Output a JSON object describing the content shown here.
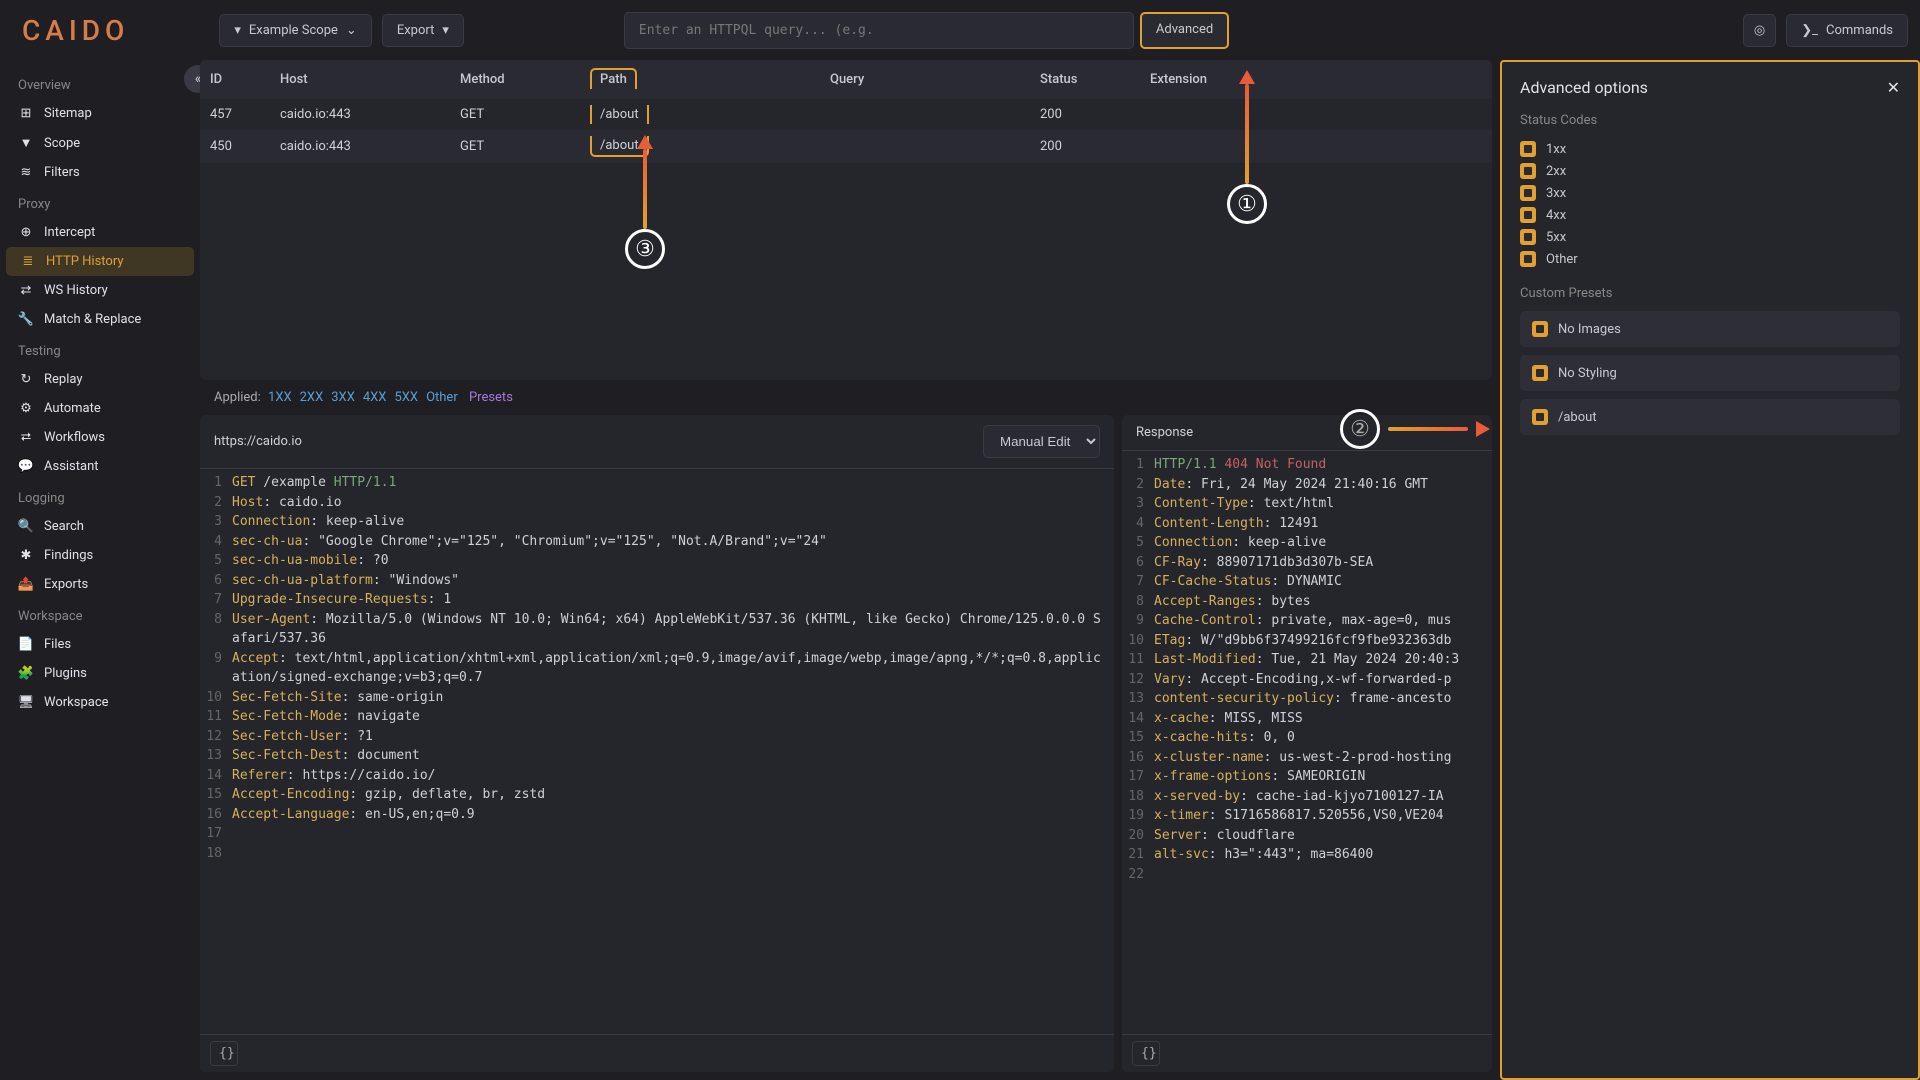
{
  "app": {
    "logo": "CAIDO"
  },
  "topbar": {
    "scope_label": "Example Scope",
    "export_label": "Export",
    "search_placeholder": "Enter an HTTPQL query... (e.g.",
    "advanced_label": "Advanced",
    "commands_label": "Commands"
  },
  "sidebar": {
    "sections": [
      {
        "title": "Overview",
        "items": [
          {
            "icon": "sitemap-icon",
            "glyph": "⊞",
            "label": "Sitemap"
          },
          {
            "icon": "scope-icon",
            "glyph": "▼",
            "label": "Scope"
          },
          {
            "icon": "filters-icon",
            "glyph": "≋",
            "label": "Filters"
          }
        ]
      },
      {
        "title": "Proxy",
        "items": [
          {
            "icon": "intercept-icon",
            "glyph": "⊕",
            "label": "Intercept"
          },
          {
            "icon": "history-icon",
            "glyph": "≣",
            "label": "HTTP History",
            "active": true
          },
          {
            "icon": "ws-icon",
            "glyph": "⇄",
            "label": "WS History"
          },
          {
            "icon": "match-icon",
            "glyph": "🔧",
            "label": "Match & Replace"
          }
        ]
      },
      {
        "title": "Testing",
        "items": [
          {
            "icon": "replay-icon",
            "glyph": "↻",
            "label": "Replay"
          },
          {
            "icon": "automate-icon",
            "glyph": "⚙",
            "label": "Automate"
          },
          {
            "icon": "workflow-icon",
            "glyph": "⮂",
            "label": "Workflows"
          },
          {
            "icon": "assistant-icon",
            "glyph": "💬",
            "label": "Assistant"
          }
        ]
      },
      {
        "title": "Logging",
        "items": [
          {
            "icon": "search-icon",
            "glyph": "🔍",
            "label": "Search"
          },
          {
            "icon": "findings-icon",
            "glyph": "✱",
            "label": "Findings"
          },
          {
            "icon": "exports-icon",
            "glyph": "📤",
            "label": "Exports"
          }
        ]
      },
      {
        "title": "Workspace",
        "items": [
          {
            "icon": "files-icon",
            "glyph": "📄",
            "label": "Files"
          },
          {
            "icon": "plugins-icon",
            "glyph": "🧩",
            "label": "Plugins"
          },
          {
            "icon": "workspace-icon",
            "glyph": "🖥",
            "label": "Workspace"
          }
        ]
      }
    ]
  },
  "table": {
    "columns": [
      "ID",
      "Host",
      "Method",
      "Path",
      "Query",
      "Status",
      "Extension"
    ],
    "rows": [
      {
        "id": "457",
        "host": "caido.io:443",
        "method": "GET",
        "path": "/about",
        "query": "",
        "status": "200",
        "ext": ""
      },
      {
        "id": "450",
        "host": "caido.io:443",
        "method": "GET",
        "path": "/about",
        "query": "",
        "status": "200",
        "ext": ""
      }
    ]
  },
  "applied": {
    "label": "Applied:",
    "chips": [
      "1XX",
      "2XX",
      "3XX",
      "4XX",
      "5XX",
      "Other"
    ],
    "presets_label": "Presets"
  },
  "request": {
    "url": "https://caido.io",
    "mode_label": "Manual Edit",
    "lines": [
      [
        {
          "c": "kw-y",
          "t": "GET"
        },
        {
          "c": "",
          "t": " /example "
        },
        {
          "c": "kw-g",
          "t": "HTTP/1.1"
        }
      ],
      [
        {
          "c": "kw-y",
          "t": "Host"
        },
        {
          "c": "",
          "t": ": caido.io"
        }
      ],
      [
        {
          "c": "kw-y",
          "t": "Connection"
        },
        {
          "c": "",
          "t": ": keep-alive"
        }
      ],
      [
        {
          "c": "kw-y",
          "t": "sec-ch-ua"
        },
        {
          "c": "",
          "t": ": \"Google Chrome\";v=\"125\", \"Chromium\";v=\"125\", \"Not.A/Brand\";v=\"24\""
        }
      ],
      [
        {
          "c": "kw-y",
          "t": "sec-ch-ua-mobile"
        },
        {
          "c": "",
          "t": ": ?0"
        }
      ],
      [
        {
          "c": "kw-y",
          "t": "sec-ch-ua-platform"
        },
        {
          "c": "",
          "t": ": \"Windows\""
        }
      ],
      [
        {
          "c": "kw-y",
          "t": "Upgrade-Insecure-Requests"
        },
        {
          "c": "",
          "t": ": 1"
        }
      ],
      [
        {
          "c": "kw-y",
          "t": "User-Agent"
        },
        {
          "c": "",
          "t": ": Mozilla/5.0 (Windows NT 10.0; Win64; x64) AppleWebKit/537.36 (KHTML, like Gecko) Chrome/125.0.0.0 Safari/537.36"
        }
      ],
      [
        {
          "c": "kw-y",
          "t": "Accept"
        },
        {
          "c": "",
          "t": ": text/html,application/xhtml+xml,application/xml;q=0.9,image/avif,image/webp,image/apng,*/*;q=0.8,application/signed-exchange;v=b3;q=0.7"
        }
      ],
      [
        {
          "c": "kw-y",
          "t": "Sec-Fetch-Site"
        },
        {
          "c": "",
          "t": ": same-origin"
        }
      ],
      [
        {
          "c": "kw-y",
          "t": "Sec-Fetch-Mode"
        },
        {
          "c": "",
          "t": ": navigate"
        }
      ],
      [
        {
          "c": "kw-y",
          "t": "Sec-Fetch-User"
        },
        {
          "c": "",
          "t": ": ?1"
        }
      ],
      [
        {
          "c": "kw-y",
          "t": "Sec-Fetch-Dest"
        },
        {
          "c": "",
          "t": ": document"
        }
      ],
      [
        {
          "c": "kw-y",
          "t": "Referer"
        },
        {
          "c": "",
          "t": ": https://caido.io/"
        }
      ],
      [
        {
          "c": "kw-y",
          "t": "Accept-Encoding"
        },
        {
          "c": "",
          "t": ": gzip, deflate, br, zstd"
        }
      ],
      [
        {
          "c": "kw-y",
          "t": "Accept-Language"
        },
        {
          "c": "",
          "t": ": en-US,en;q=0.9"
        }
      ],
      [
        {
          "c": "",
          "t": ""
        }
      ],
      [
        {
          "c": "",
          "t": ""
        }
      ]
    ]
  },
  "response": {
    "title": "Response",
    "lines": [
      [
        {
          "c": "kw-g",
          "t": "HTTP/1.1 "
        },
        {
          "c": "kw-r",
          "t": "404 Not Found"
        }
      ],
      [
        {
          "c": "kw-y",
          "t": "Date"
        },
        {
          "c": "",
          "t": ": Fri, 24 May 2024 21:40:16 GMT"
        }
      ],
      [
        {
          "c": "kw-y",
          "t": "Content-Type"
        },
        {
          "c": "",
          "t": ": text/html"
        }
      ],
      [
        {
          "c": "kw-y",
          "t": "Content-Length"
        },
        {
          "c": "",
          "t": ": 12491"
        }
      ],
      [
        {
          "c": "kw-y",
          "t": "Connection"
        },
        {
          "c": "",
          "t": ": keep-alive"
        }
      ],
      [
        {
          "c": "kw-y",
          "t": "CF-Ray"
        },
        {
          "c": "",
          "t": ": 88907171db3d307b-SEA"
        }
      ],
      [
        {
          "c": "kw-y",
          "t": "CF-Cache-Status"
        },
        {
          "c": "",
          "t": ": DYNAMIC"
        }
      ],
      [
        {
          "c": "kw-y",
          "t": "Accept-Ranges"
        },
        {
          "c": "",
          "t": ": bytes"
        }
      ],
      [
        {
          "c": "kw-y",
          "t": "Cache-Control"
        },
        {
          "c": "",
          "t": ": private, max-age=0, mus"
        }
      ],
      [
        {
          "c": "kw-y",
          "t": "ETag"
        },
        {
          "c": "",
          "t": ": W/\"d9bb6f37499216fcf9fbe932363db"
        }
      ],
      [
        {
          "c": "kw-y",
          "t": "Last-Modified"
        },
        {
          "c": "",
          "t": ": Tue, 21 May 2024 20:40:3"
        }
      ],
      [
        {
          "c": "kw-y",
          "t": "Vary"
        },
        {
          "c": "",
          "t": ": Accept-Encoding,x-wf-forwarded-p"
        }
      ],
      [
        {
          "c": "kw-y",
          "t": "content-security-policy"
        },
        {
          "c": "",
          "t": ": frame-ancesto"
        }
      ],
      [
        {
          "c": "kw-y",
          "t": "x-cache"
        },
        {
          "c": "",
          "t": ": MISS, MISS"
        }
      ],
      [
        {
          "c": "kw-y",
          "t": "x-cache-hits"
        },
        {
          "c": "",
          "t": ": 0, 0"
        }
      ],
      [
        {
          "c": "kw-y",
          "t": "x-cluster-name"
        },
        {
          "c": "",
          "t": ": us-west-2-prod-hosting"
        }
      ],
      [
        {
          "c": "kw-y",
          "t": "x-frame-options"
        },
        {
          "c": "",
          "t": ": SAMEORIGIN"
        }
      ],
      [
        {
          "c": "kw-y",
          "t": "x-served-by"
        },
        {
          "c": "",
          "t": ": cache-iad-kjyo7100127-IA"
        }
      ],
      [
        {
          "c": "kw-y",
          "t": "x-timer"
        },
        {
          "c": "",
          "t": ": S1716586817.520556,VS0,VE204"
        }
      ],
      [
        {
          "c": "kw-y",
          "t": "Server"
        },
        {
          "c": "",
          "t": ": cloudflare"
        }
      ],
      [
        {
          "c": "kw-y",
          "t": "alt-svc"
        },
        {
          "c": "",
          "t": ": h3=\":443\"; ma=86400"
        }
      ],
      [
        {
          "c": "",
          "t": ""
        }
      ]
    ]
  },
  "advanced_panel": {
    "title": "Advanced options",
    "status_label": "Status Codes",
    "status_codes": [
      "1xx",
      "2xx",
      "3xx",
      "4xx",
      "5xx",
      "Other"
    ],
    "presets_label": "Custom Presets",
    "presets": [
      "No Images",
      "No Styling",
      "/about"
    ]
  },
  "annotations": {
    "one": "①",
    "two": "②",
    "three": "③"
  }
}
